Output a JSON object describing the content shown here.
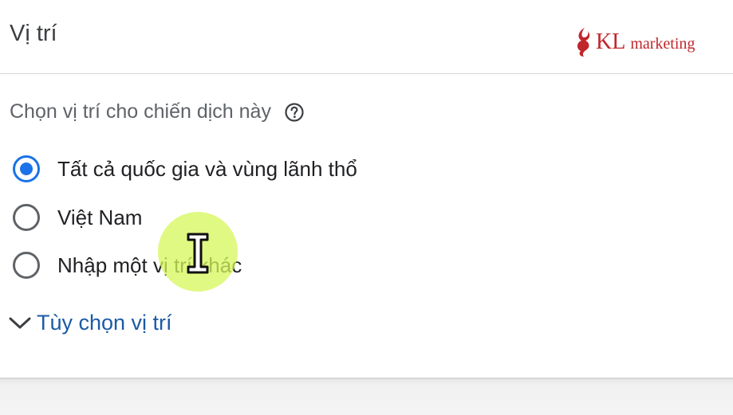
{
  "header": {
    "title": "Vị trí",
    "logo": {
      "kl": "KL",
      "text": "marketing",
      "color": "#c0272d"
    }
  },
  "location": {
    "prompt": "Chọn vị trí cho chiến dịch này",
    "help_icon": "help-circle-icon",
    "options": [
      {
        "label": "Tất cả quốc gia và vùng lãnh thổ",
        "selected": true
      },
      {
        "label": "Việt Nam",
        "selected": false
      },
      {
        "label": "Nhập một vị trí khác",
        "selected": false
      }
    ],
    "expander_label": "Tùy chọn vị trí",
    "expander_icon": "chevron-down-icon"
  },
  "colors": {
    "accent": "#1a73e8",
    "link": "#1a5aa6",
    "cursor_highlight": "#d6f75a"
  }
}
